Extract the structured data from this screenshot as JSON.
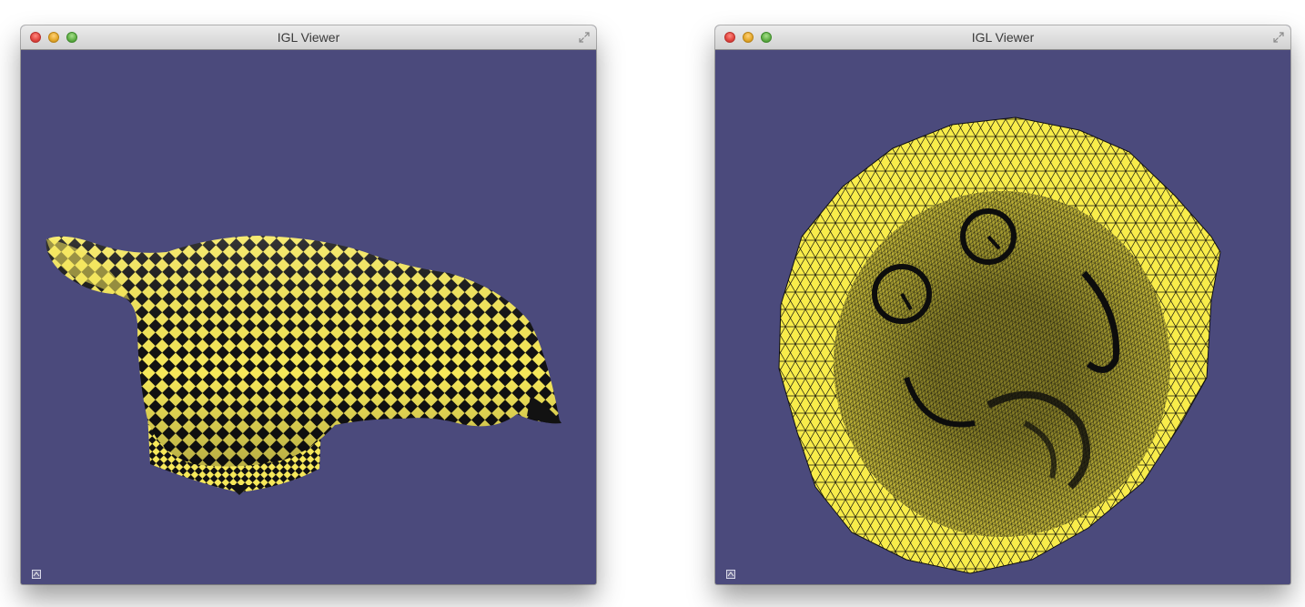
{
  "windows": [
    {
      "title": "IGL Viewer",
      "content": "checkerboard-textured-mesh"
    },
    {
      "title": "IGL Viewer",
      "content": "wireframe-parameterization-mesh"
    }
  ],
  "colors": {
    "viewport_background": "#4b4a7c",
    "mesh_yellow": "#f8ec4a",
    "mesh_black": "#111111"
  },
  "icons": [
    "traffic-light-close-icon",
    "traffic-light-minimize-icon",
    "traffic-light-zoom-icon",
    "fullscreen-icon",
    "menu-toggle-icon",
    "help-icon"
  ]
}
